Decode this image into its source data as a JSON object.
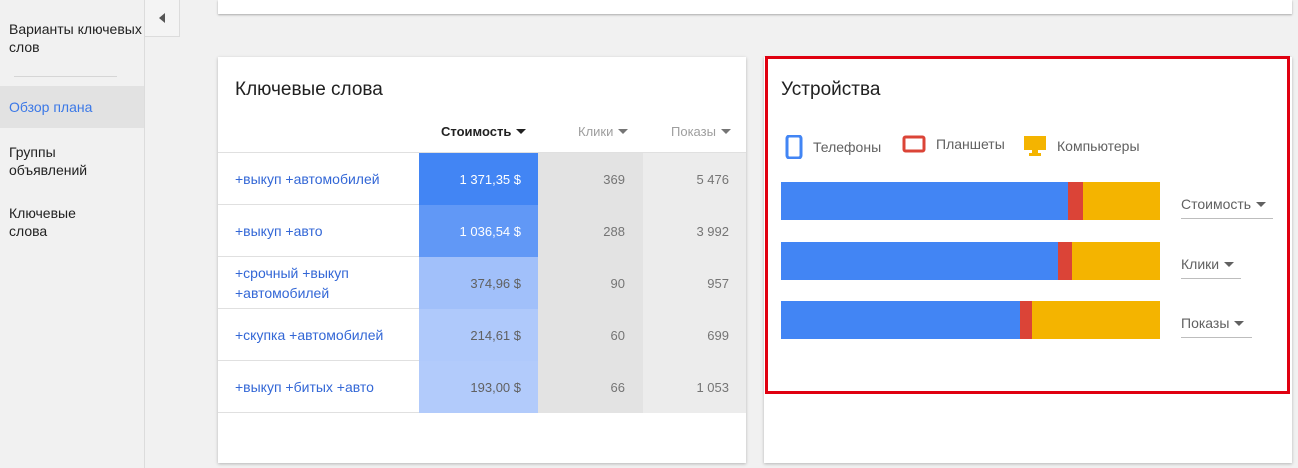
{
  "sidebar": {
    "items": [
      {
        "label": "Варианты ключевых слов",
        "active": false
      },
      {
        "label": "Обзор плана",
        "active": true
      },
      {
        "label": "Группы объявлений",
        "active": false
      },
      {
        "label": "Ключевые слова",
        "active": false
      }
    ]
  },
  "collapse": {
    "icon": "chevron-left-icon"
  },
  "keywords_card": {
    "title": "Ключевые слова",
    "columns": {
      "cost": "Стоимость",
      "clicks": "Клики",
      "impressions": "Показы"
    },
    "rows": [
      {
        "keyword": "+выкуп +автомобилей",
        "cost": "1 371,35 $",
        "clicks": "369",
        "impressions": "5 476",
        "cost_level": 1.0
      },
      {
        "keyword": "+выкуп +авто",
        "cost": "1 036,54 $",
        "clicks": "288",
        "impressions": "3 992",
        "cost_level": 0.76
      },
      {
        "keyword": "+срочный +выкуп +автомобилей",
        "cost": "374,96 $",
        "clicks": "90",
        "impressions": "957",
        "cost_level": 0.27
      },
      {
        "keyword": "+скупка +автомобилей",
        "cost": "214,61 $",
        "clicks": "60",
        "impressions": "699",
        "cost_level": 0.16
      },
      {
        "keyword": "+выкуп +битых +авто",
        "cost": "193,00 $",
        "clicks": "66",
        "impressions": "1 053",
        "cost_level": 0.14
      }
    ]
  },
  "devices_card": {
    "title": "Устройства",
    "legend": [
      {
        "label": "Телефоны",
        "color": "#4285f4",
        "icon": "phone-icon"
      },
      {
        "label": "Планшеты",
        "color": "#db4437",
        "icon": "tablet-icon"
      },
      {
        "label": "Компьютеры",
        "color": "#f4b400",
        "icon": "desktop-icon"
      }
    ],
    "metrics": [
      {
        "label": "Стоимость",
        "shares": [
          0.757,
          0.04,
          0.203
        ]
      },
      {
        "label": "Клики",
        "shares": [
          0.73,
          0.037,
          0.233
        ]
      },
      {
        "label": "Показы",
        "shares": [
          0.63,
          0.032,
          0.338
        ]
      }
    ]
  }
}
